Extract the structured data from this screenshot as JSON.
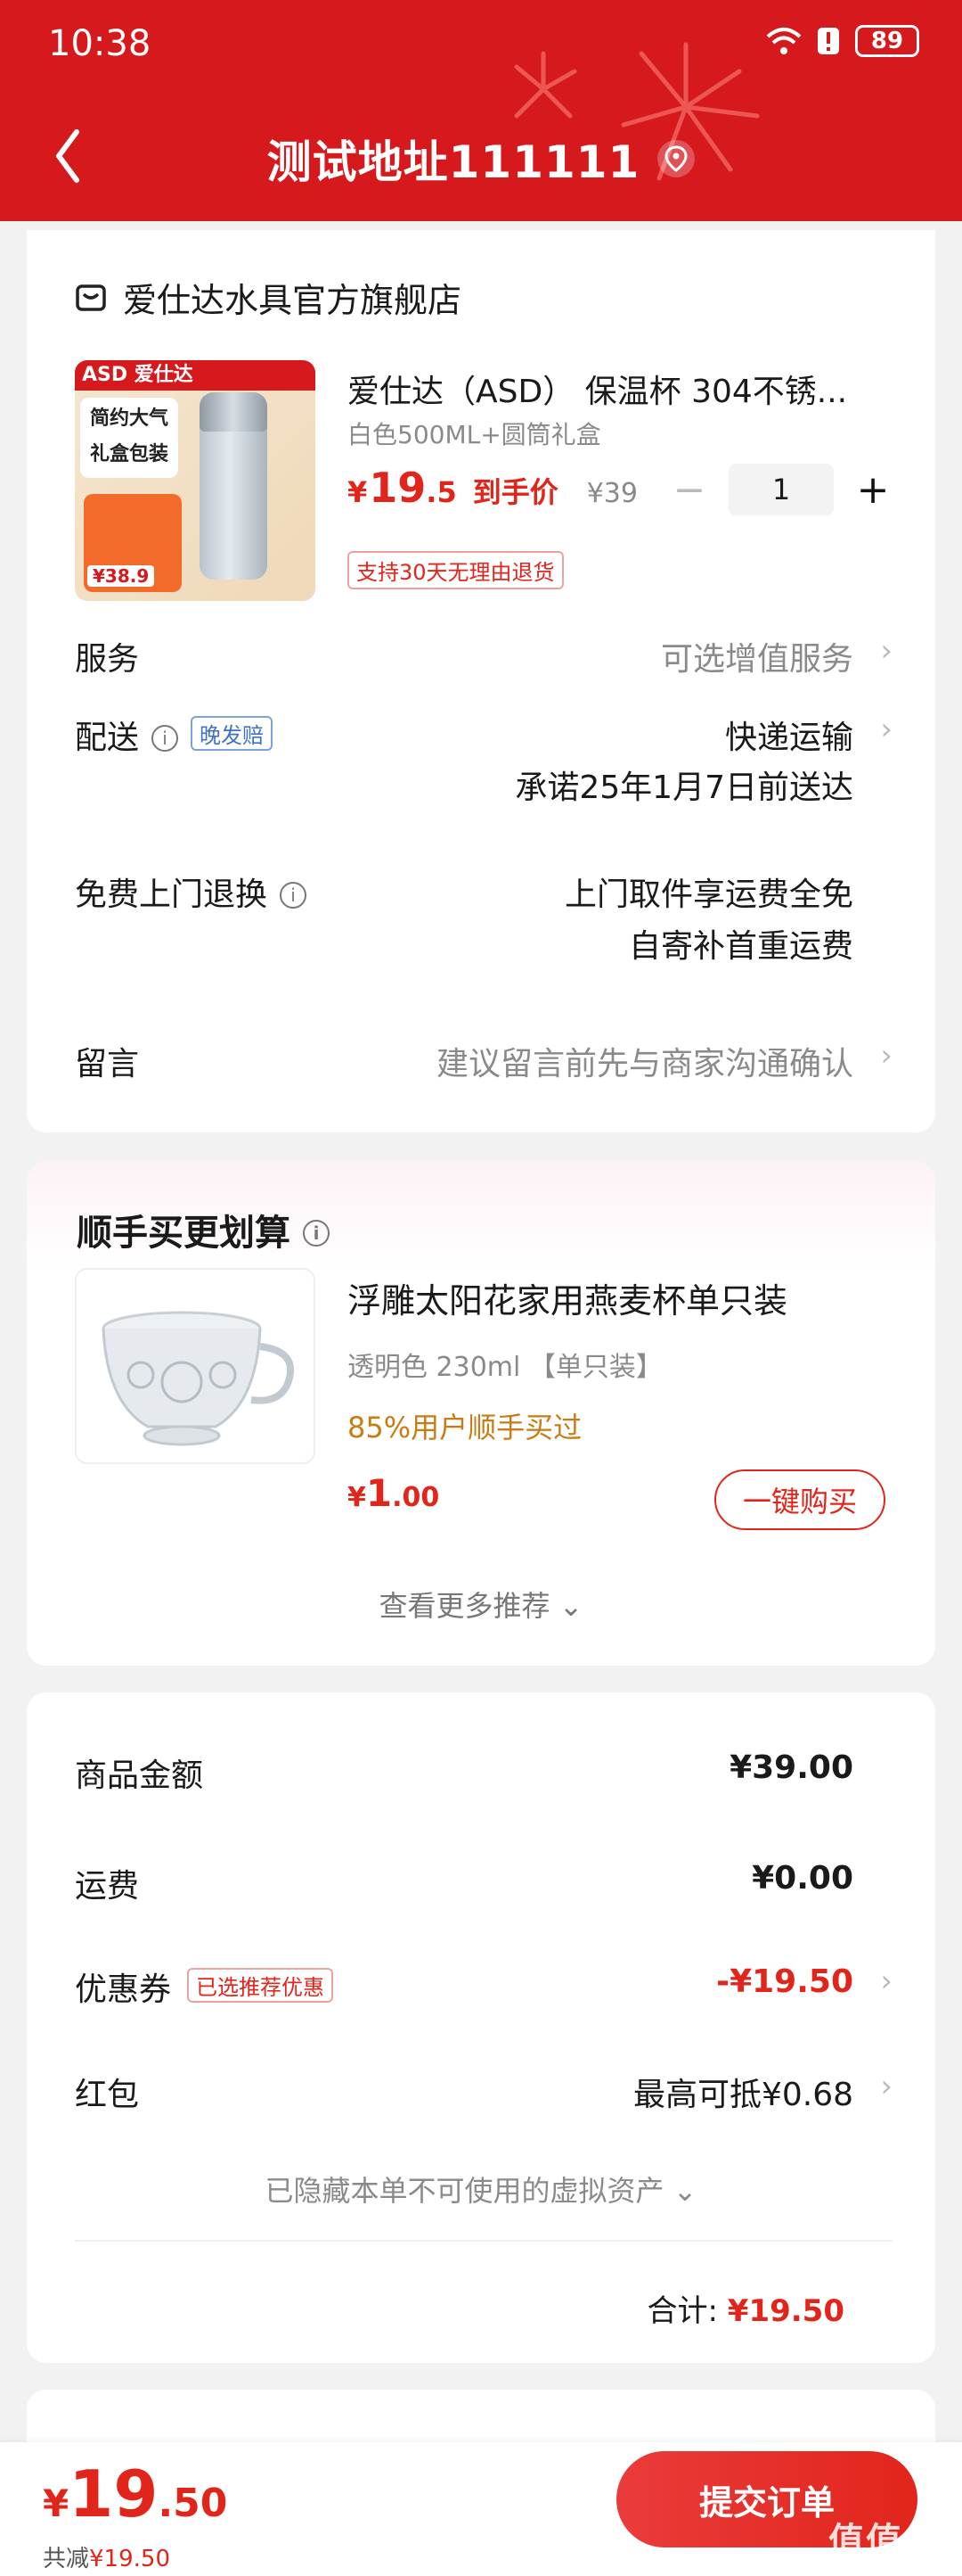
{
  "status": {
    "time": "10:38",
    "battery": "89"
  },
  "header": {
    "title": "测试地址111111"
  },
  "shop": {
    "name": "爱仕达水具官方旗舰店",
    "product": {
      "name": "爱仕达（ASD） 保温杯 304不锈...",
      "spec": "白色500ML+圆筒礼盒",
      "price_currency": "¥",
      "price_int": "19",
      "price_dec": ".5",
      "price_label": "到手价",
      "orig_price": "¥39",
      "qty": "1",
      "return_badge": "支持30天无理由退货",
      "thumb_brand": "ASD 爱仕达",
      "thumb_text": "简约大气 礼盒包装",
      "thumb_price": "¥38.9"
    },
    "rows": {
      "service_label": "服务",
      "service_value": "可选增值服务",
      "delivery_label": "配送",
      "delivery_badge": "晚发赔",
      "delivery_value": "快递运输",
      "delivery_promise": "承诺25年1月7日前送达",
      "return_label": "免费上门退换",
      "return_line1": "上门取件享运费全免",
      "return_line2": "自寄补首重运费",
      "note_label": "留言",
      "note_placeholder": "建议留言前先与商家沟通确认"
    }
  },
  "recommend": {
    "title": "顺手买更划算",
    "name": "浮雕太阳花家用燕麦杯单只装",
    "spec": "透明色 230ml  【单只装】",
    "hint": "85%用户顺手买过",
    "price_currency": "¥",
    "price_int": "1",
    "price_dec": ".00",
    "buy_label": "一键购买",
    "more_label": "查看更多推荐 ⌄"
  },
  "summary": {
    "goods_label": "商品金额",
    "goods_value": "¥39.00",
    "ship_label": "运费",
    "ship_value": "¥0.00",
    "coupon_label": "优惠券",
    "coupon_badge": "已选推荐优惠",
    "coupon_value": "-¥19.50",
    "redpack_label": "红包",
    "redpack_value": "最高可抵¥0.68",
    "hidden_assets": "已隐藏本单不可使用的虚拟资产 ⌄",
    "total_label": "合计:",
    "total_value": "¥19.50"
  },
  "bottom": {
    "currency": "¥",
    "price_int": "19",
    "price_dec": ".50",
    "discount_label": "共减",
    "discount_value": "¥19.50",
    "submit_label": "提交订单",
    "watermark": "值值值"
  },
  "colors": {
    "brand_red": "#d6191c",
    "price_red": "#e1251b",
    "hint_orange": "#c77c14"
  }
}
